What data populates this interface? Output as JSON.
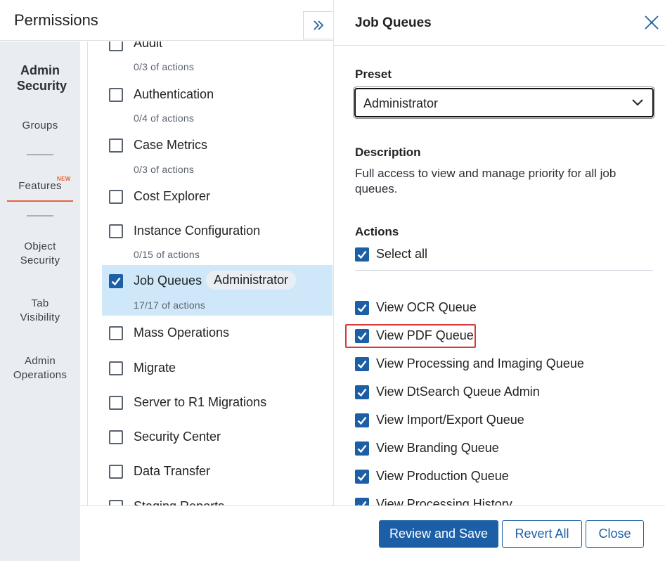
{
  "header": {
    "title": "Permissions"
  },
  "leftnav": {
    "heading": "Admin Security",
    "items": [
      {
        "label": "Groups"
      },
      {
        "label": "Features",
        "badge": "NEW",
        "active": true
      },
      {
        "label": "Object Security"
      },
      {
        "label": "Tab Visibility"
      },
      {
        "label": "Admin Operations"
      }
    ]
  },
  "features": [
    {
      "label": "Audit",
      "sub": "0/3 of actions",
      "checked": false
    },
    {
      "label": "Authentication",
      "sub": "0/4 of actions",
      "checked": false
    },
    {
      "label": "Case Metrics",
      "sub": "0/3 of actions",
      "checked": false
    },
    {
      "label": "Cost Explorer",
      "sub": "",
      "checked": false
    },
    {
      "label": "Instance Configuration",
      "sub": "0/15 of actions",
      "checked": false
    },
    {
      "label": "Job Queues",
      "pill": "Administrator",
      "sub": "17/17 of actions",
      "checked": true,
      "selected": true
    },
    {
      "label": "Mass Operations",
      "sub": "",
      "checked": false
    },
    {
      "label": "Migrate",
      "sub": "",
      "checked": false
    },
    {
      "label": "Server to R1 Migrations",
      "sub": "",
      "checked": false
    },
    {
      "label": "Security Center",
      "sub": "",
      "checked": false
    },
    {
      "label": "Data Transfer",
      "sub": "",
      "checked": false
    },
    {
      "label": "Staging Reports",
      "sub": "",
      "checked": false
    }
  ],
  "detail": {
    "title": "Job Queues",
    "preset_label": "Preset",
    "preset_value": "Administrator",
    "description_label": "Description",
    "description": "Full access to view and manage priority for all job queues.",
    "actions_label": "Actions",
    "select_all": "Select all",
    "actions": [
      "View OCR Queue",
      "View PDF Queue",
      "View Processing and Imaging Queue",
      "View DtSearch Queue Admin",
      "View Import/Export Queue",
      "View Branding Queue",
      "View Production Queue",
      "View Processing History"
    ]
  },
  "footer": {
    "review_save": "Review and Save",
    "revert_all": "Revert All",
    "close": "Close"
  },
  "colors": {
    "primary": "#1d5fa6",
    "accent": "#e2643a",
    "selected_row": "#cfe8f9",
    "highlight_border": "#d6393a",
    "nav_bg": "#e9edf2"
  }
}
